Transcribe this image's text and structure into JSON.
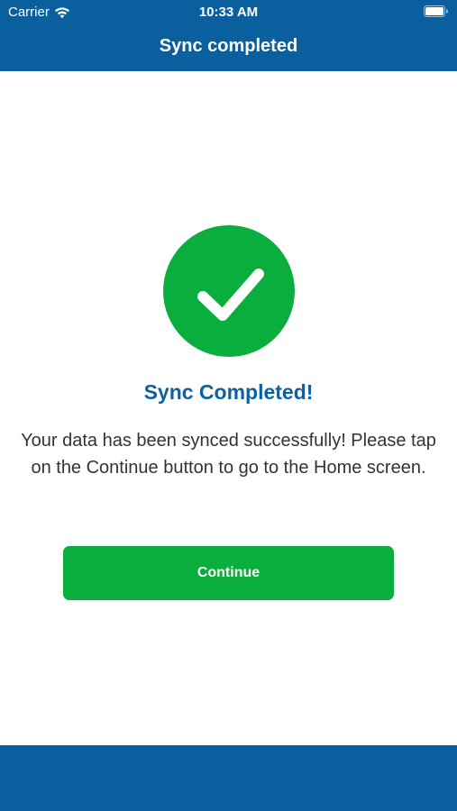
{
  "status_bar": {
    "carrier": "Carrier",
    "time": "10:33 AM",
    "wifi_icon": "wifi-icon",
    "battery_icon": "battery-full-icon"
  },
  "nav": {
    "title": "Sync completed"
  },
  "content": {
    "status_icon": "check-circle-icon",
    "heading": "Sync Completed!",
    "message": "Your data has been synced successfully! Please tap on the Continue button to go to the Home screen.",
    "continue_label": "Continue"
  },
  "colors": {
    "header_blue": "#0a5f9e",
    "heading_blue": "#0b62a3",
    "success_green": "#0aae3d",
    "text_gray": "#333333"
  }
}
